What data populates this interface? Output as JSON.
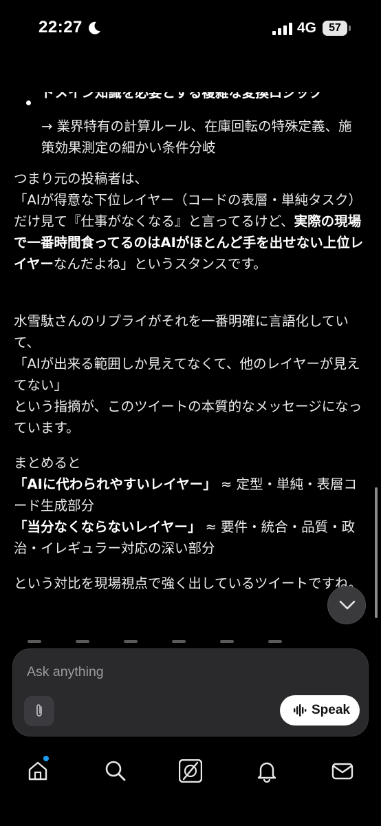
{
  "status_bar": {
    "time": "22:27",
    "network": "4G",
    "battery": "57"
  },
  "message": {
    "bullet_title": "ドメイン知識を必要とする複雑な変換ロジック",
    "bullet_sub": "→ 業界特有の計算ルール、在庫回転の特殊定義、施策効果測定の細かい条件分岐",
    "p1_a": "つまり元の投稿者は、",
    "p1_b": "「AIが得意な下位レイヤー（コードの表層・単純タスク）だけ見て『仕事がなくなる』と言ってるけど、",
    "p1_bold": "実際の現場で一番時間食ってるのはAIがほとんど手を出せない上位レイヤー",
    "p1_c": "なんだよね」というスタンスです。",
    "p2_a": "水雪駄さんのリプライがそれを一番明確に言語化していて、",
    "p2_b": "「AIが出来る範囲しか見えてなくて、他のレイヤーが見えてない」",
    "p2_c": "という指摘が、このツイートの本質的なメッセージになっています。",
    "p3_intro": "まとめると",
    "p3_bold1": "「AIに代わられやすいレイヤー」",
    "p3_rest1": "≈ 定型・単純・表層コード生成部分",
    "p3_bold2": "「当分なくならないレイヤー」",
    "p3_rest2": "≈ 要件・統合・品質・政治・イレギュラー対応の深い部分",
    "p4": "という対比を現場視点で強く出しているツイートですね。"
  },
  "composer": {
    "placeholder": "Ask anything",
    "speak_label": "Speak"
  },
  "tabs": {
    "home": "home-icon",
    "search": "search-icon",
    "grok": "grok-icon",
    "notifications": "bell-icon",
    "messages": "mail-icon"
  },
  "colors": {
    "background": "#000000",
    "composer": "#2a2a2c",
    "accent_dot": "#1d9bf0"
  }
}
